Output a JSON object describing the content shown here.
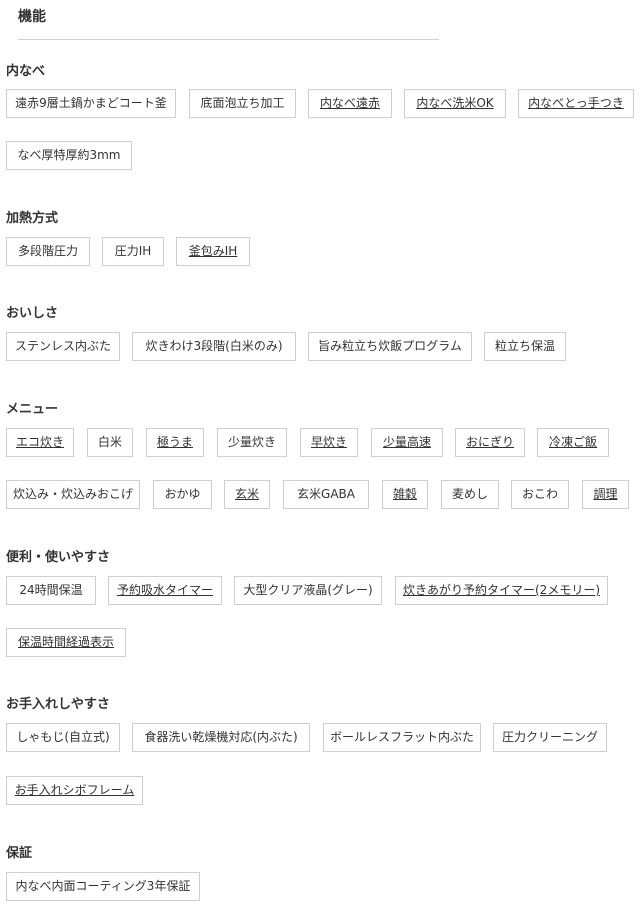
{
  "header": {
    "title": "機能"
  },
  "sections": {
    "uchinabe": {
      "title": "内なべ",
      "tags": [
        "遠赤9層土鍋かまどコート釜",
        "底面泡立ち加工",
        "内なべ遠赤",
        "内なべ洗米OK",
        "内なべとっ手つき",
        "なべ厚特厚約3mm"
      ]
    },
    "kanetsu": {
      "title": "加熱方式",
      "tags": [
        "多段階圧力",
        "圧力IH",
        "釜包みIH"
      ]
    },
    "oishisa": {
      "title": "おいしさ",
      "tags": [
        "ステンレス内ぶた",
        "炊きわけ3段階(白米のみ)",
        "旨み粒立ち炊飯プログラム",
        "粒立ち保温"
      ]
    },
    "menu": {
      "title": "メニュー",
      "tags": [
        "エコ炊き",
        "白米",
        "極うま",
        "少量炊き",
        "早炊き",
        "少量高速",
        "おにぎり",
        "冷凍ご飯",
        "炊込み・炊込みおこげ",
        "おかゆ",
        "玄米",
        "玄米GABA",
        "雑穀",
        "麦めし",
        "おこわ",
        "調理"
      ]
    },
    "benri": {
      "title": "便利・使いやすさ",
      "tags": [
        "24時間保温",
        "予約吸水タイマー",
        "大型クリア液晶(グレー)",
        "炊きあがり予約タイマー(2メモリー)",
        "保温時間経過表示"
      ]
    },
    "teire": {
      "title": "お手入れしやすさ",
      "tags": [
        "しゃもじ(自立式)",
        "食器洗い乾燥機対応(内ぶた)",
        "ボールレスフラット内ぶた",
        "圧力クリーニング",
        "お手入れシボフレーム"
      ]
    },
    "hosho": {
      "title": "保証",
      "tags": [
        "内なべ内面コーティング3年保証"
      ]
    }
  }
}
